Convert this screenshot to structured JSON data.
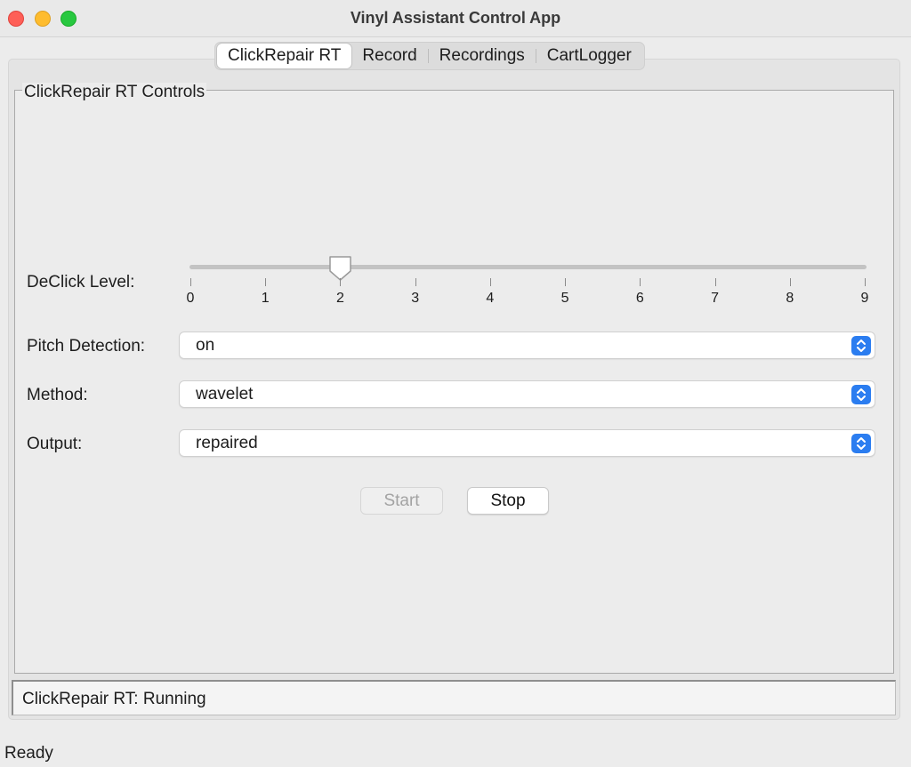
{
  "window": {
    "title": "Vinyl Assistant Control App"
  },
  "tabs": [
    {
      "label": "ClickRepair RT",
      "active": true
    },
    {
      "label": "Record",
      "active": false
    },
    {
      "label": "Recordings",
      "active": false
    },
    {
      "label": "CartLogger",
      "active": false
    }
  ],
  "group": {
    "title": "ClickRepair RT Controls"
  },
  "declick": {
    "label": "DeClick Level:",
    "value": 2,
    "min": 0,
    "max": 9,
    "ticks": [
      "0",
      "1",
      "2",
      "3",
      "4",
      "5",
      "6",
      "7",
      "8",
      "9"
    ]
  },
  "pitch_detection": {
    "label": "Pitch Detection:",
    "value": "on"
  },
  "method": {
    "label": "Method:",
    "value": "wavelet"
  },
  "output": {
    "label": "Output:",
    "value": "repaired"
  },
  "buttons": {
    "start": "Start",
    "stop": "Stop"
  },
  "status": {
    "text": "ClickRepair RT: Running"
  },
  "footer": {
    "text": "Ready"
  },
  "colors": {
    "accent": "#2b7df0"
  },
  "icons": [
    "close-window-icon",
    "minimize-window-icon",
    "maximize-window-icon",
    "select-arrows-icon"
  ]
}
